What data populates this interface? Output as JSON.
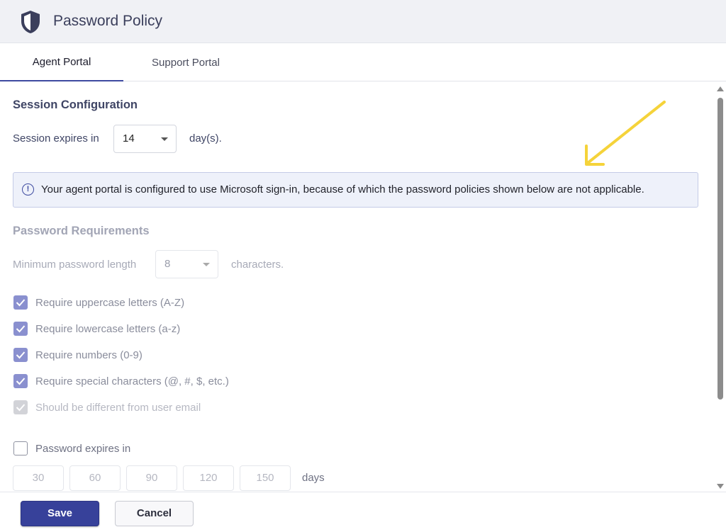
{
  "header": {
    "title": "Password Policy",
    "icon": "shield-icon"
  },
  "tabs": [
    {
      "label": "Agent Portal",
      "active": true
    },
    {
      "label": "Support Portal",
      "active": false
    }
  ],
  "session": {
    "section_title": "Session Configuration",
    "label": "Session expires in",
    "value": "14",
    "unit": "day(s)."
  },
  "banner": {
    "icon": "info-icon",
    "message": "Your agent portal is configured to use Microsoft sign-in, because of which the password policies shown below are not applicable."
  },
  "password_requirements": {
    "section_title": "Password Requirements",
    "min_length_label": "Minimum password length",
    "min_length_value": "8",
    "min_length_unit": "characters.",
    "checks": [
      {
        "label": "Require uppercase letters (A-Z)",
        "checked": true
      },
      {
        "label": "Require lowercase letters (a-z)",
        "checked": true
      },
      {
        "label": "Require numbers (0-9)",
        "checked": true
      },
      {
        "label": "Require special characters (@, #, $, etc.)",
        "checked": true
      },
      {
        "label": "Should be different from user email",
        "checked": true
      }
    ],
    "expires_label": "Password expires in",
    "expires_checked": false,
    "expiry_options": [
      "30",
      "60",
      "90",
      "120",
      "150"
    ],
    "expiry_unit": "days"
  },
  "footer": {
    "save_label": "Save",
    "cancel_label": "Cancel"
  },
  "colors": {
    "primary": "#37419a",
    "annotation_arrow": "#f5d33a"
  }
}
